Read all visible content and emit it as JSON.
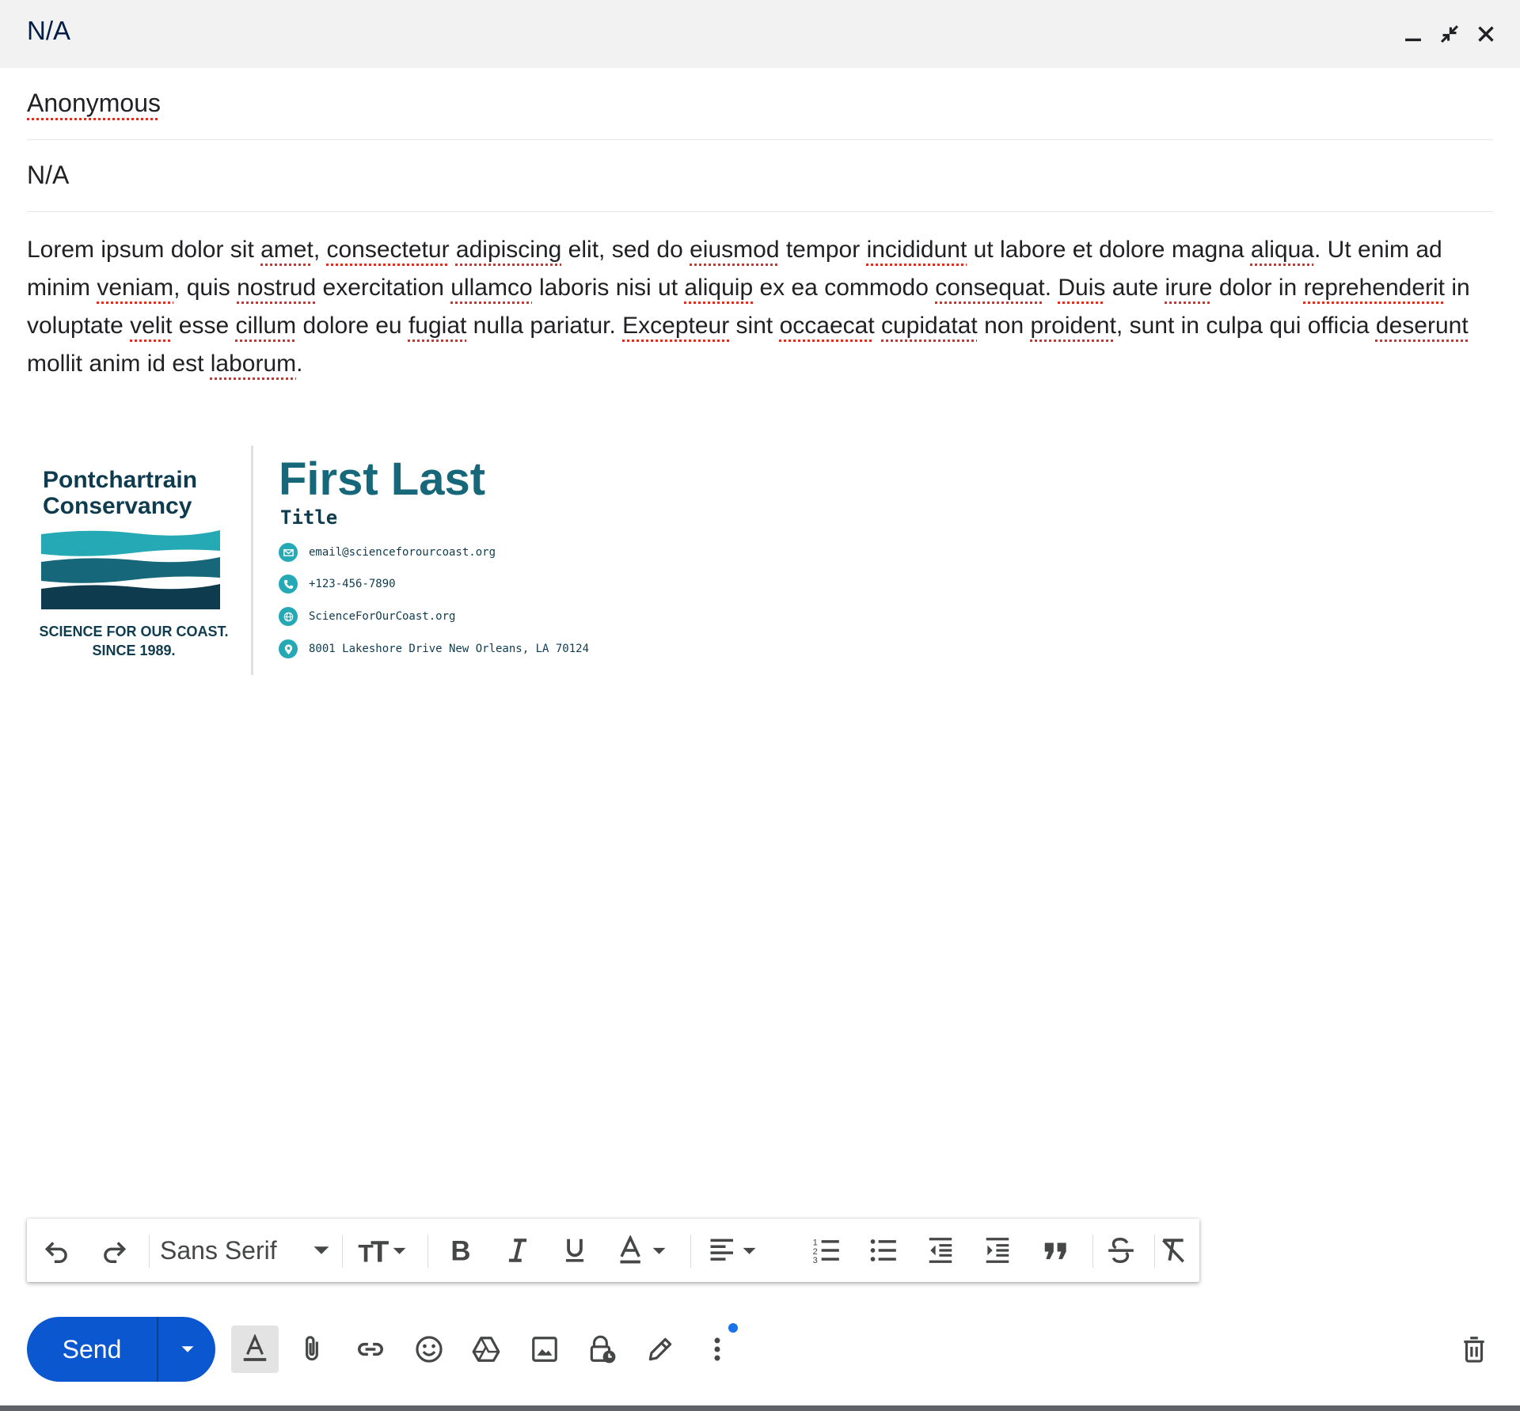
{
  "window": {
    "title": "N/A"
  },
  "fields": {
    "to": "Anonymous",
    "subject": "N/A"
  },
  "body": {
    "segments": [
      {
        "t": "Lorem ipsum dolor sit "
      },
      {
        "t": "amet",
        "s": 1
      },
      {
        "t": ", "
      },
      {
        "t": "consectetur",
        "s": 1
      },
      {
        "t": " "
      },
      {
        "t": "adipiscing",
        "s": 1
      },
      {
        "t": " elit, sed do "
      },
      {
        "t": "eiusmod",
        "s": 1
      },
      {
        "t": " tempor "
      },
      {
        "t": "incididunt",
        "s": 1
      },
      {
        "t": " ut labore et dolore magna "
      },
      {
        "t": "aliqua",
        "s": 1
      },
      {
        "t": ". Ut enim ad minim "
      },
      {
        "t": "veniam",
        "s": 1
      },
      {
        "t": ", quis "
      },
      {
        "t": "nostrud",
        "s": 1
      },
      {
        "t": " exercitation "
      },
      {
        "t": "ullamco",
        "s": 1
      },
      {
        "t": " laboris nisi ut "
      },
      {
        "t": "aliquip",
        "s": 1
      },
      {
        "t": " ex ea commodo "
      },
      {
        "t": "consequat",
        "s": 1
      },
      {
        "t": ". "
      },
      {
        "t": "Duis",
        "s": 1
      },
      {
        "t": " aute "
      },
      {
        "t": "irure",
        "s": 1
      },
      {
        "t": " dolor in "
      },
      {
        "t": "reprehenderit",
        "s": 1
      },
      {
        "t": " in voluptate "
      },
      {
        "t": "velit",
        "s": 1
      },
      {
        "t": " esse "
      },
      {
        "t": "cillum",
        "s": 1
      },
      {
        "t": " dolore eu "
      },
      {
        "t": "fugiat",
        "s": 1
      },
      {
        "t": " nulla pariatur. "
      },
      {
        "t": "Excepteur",
        "s": 1
      },
      {
        "t": " sint "
      },
      {
        "t": "occaecat",
        "s": 1
      },
      {
        "t": " "
      },
      {
        "t": "cupidatat",
        "s": 1
      },
      {
        "t": " non "
      },
      {
        "t": "proident",
        "s": 1
      },
      {
        "t": ", sunt in culpa qui officia "
      },
      {
        "t": "deserunt",
        "s": 1
      },
      {
        "t": " mollit anim id est "
      },
      {
        "t": "laborum",
        "s": 1
      },
      {
        "t": "."
      }
    ]
  },
  "signature": {
    "org_line1": "Pontchartrain",
    "org_line2": "Conservancy",
    "tagline_line1": "SCIENCE FOR OUR COAST.",
    "tagline_line2": "SINCE 1989.",
    "name": "First Last",
    "title": "Title",
    "email": "email@scienceforourcoast.org",
    "phone": "+123-456-7890",
    "website": "ScienceForOurCoast.org",
    "address": "8001 Lakeshore Drive New Orleans, LA 70124",
    "colors": {
      "dark": "#0e3c4e",
      "teal": "#16677a",
      "accent": "#24a9b5"
    }
  },
  "toolbar": {
    "font": "Sans Serif"
  },
  "footer": {
    "send_label": "Send"
  },
  "colors": {
    "send_button": "#0b57d0",
    "notification_dot": "#1a73e8"
  }
}
